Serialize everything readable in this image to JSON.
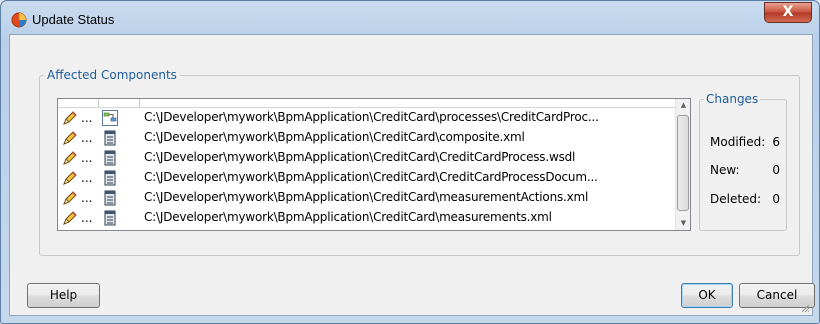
{
  "window": {
    "title": "Update Status",
    "close_label": "X"
  },
  "affected_components": {
    "legend": "Affected Components",
    "rows": [
      {
        "status": "...",
        "type_icon": "process-icon",
        "path": "C:\\JDeveloper\\mywork\\BpmApplication\\CreditCard\\processes\\CreditCardProc..."
      },
      {
        "status": "...",
        "type_icon": "document-icon",
        "path": "C:\\JDeveloper\\mywork\\BpmApplication\\CreditCard\\composite.xml"
      },
      {
        "status": "...",
        "type_icon": "document-icon",
        "path": "C:\\JDeveloper\\mywork\\BpmApplication\\CreditCard\\CreditCardProcess.wsdl"
      },
      {
        "status": "...",
        "type_icon": "document-icon",
        "path": "C:\\JDeveloper\\mywork\\BpmApplication\\CreditCard\\CreditCardProcessDocum..."
      },
      {
        "status": "...",
        "type_icon": "document-icon",
        "path": "C:\\JDeveloper\\mywork\\BpmApplication\\CreditCard\\measurementActions.xml"
      },
      {
        "status": "...",
        "type_icon": "document-icon",
        "path": "C:\\JDeveloper\\mywork\\BpmApplication\\CreditCard\\measurements.xml"
      }
    ]
  },
  "changes": {
    "legend": "Changes",
    "modified_label": "Modified:",
    "modified_value": "6",
    "new_label": "New:",
    "new_value": "0",
    "deleted_label": "Deleted:",
    "deleted_value": "0"
  },
  "buttons": {
    "help": "Help",
    "ok": "OK",
    "cancel": "Cancel"
  },
  "colors": {
    "accent": "#1d5c9c",
    "close": "#c7503b",
    "title_bg": "#c9dcef"
  }
}
